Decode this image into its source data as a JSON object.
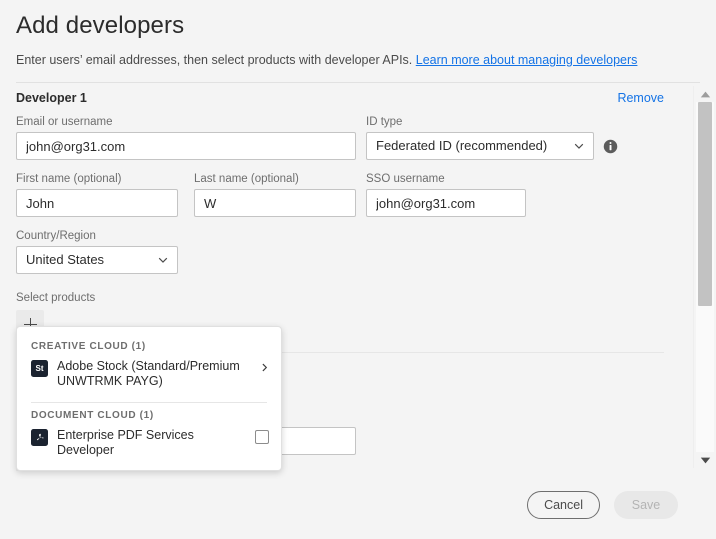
{
  "header": {
    "title": "Add developers",
    "subtitle_text": "Enter users’ email addresses, then select products with developer APIs.",
    "subtitle_link": "Learn more about managing developers"
  },
  "developer_section": {
    "title": "Developer 1",
    "remove_label": "Remove",
    "fields": {
      "email": {
        "label": "Email or username",
        "value": "john@org31.com"
      },
      "id_type": {
        "label": "ID type",
        "value": "Federated ID (recommended)"
      },
      "first_name": {
        "label": "First name (optional)",
        "value": "John"
      },
      "last_name": {
        "label": "Last name (optional)",
        "value": "W"
      },
      "sso_username": {
        "label": "SSO username",
        "value": "john@org31.com"
      },
      "country": {
        "label": "Country/Region",
        "value": "United States"
      }
    }
  },
  "select_products": {
    "label": "Select products",
    "add_button_glyph": "+"
  },
  "product_popup": {
    "groups": [
      {
        "title": "CREATIVE CLOUD (1)",
        "items": [
          {
            "icon_text": "St",
            "icon_name": "adobe-stock-icon",
            "label": "Adobe Stock (Standard/Premium UNWTRMK PAYG)",
            "control": "chevron"
          }
        ]
      },
      {
        "title": "DOCUMENT CLOUD (1)",
        "items": [
          {
            "icon_text": "",
            "icon_name": "acrobat-pdf-icon",
            "label": "Enterprise PDF Services Developer",
            "control": "checkbox"
          }
        ]
      }
    ]
  },
  "footer": {
    "cancel_label": "Cancel",
    "save_label": "Save"
  },
  "colors": {
    "accent_link": "#1473e6",
    "background": "#f4f4f4",
    "text_primary": "#2c2c2c",
    "text_secondary": "#6e6e6e",
    "border": "#c4c4c4",
    "product_icon": "#1b2330"
  }
}
